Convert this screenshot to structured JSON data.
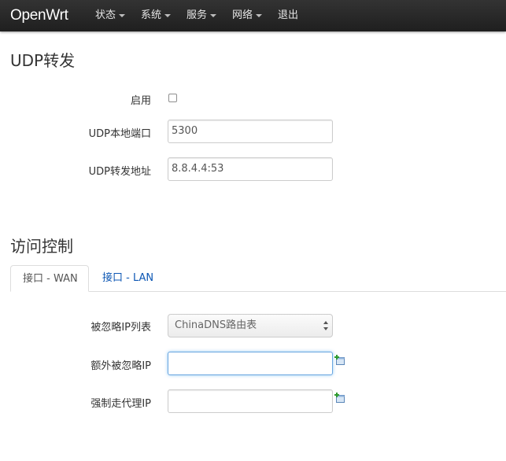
{
  "navbar": {
    "brand": "OpenWrt",
    "items": [
      {
        "label": "状态",
        "dropdown": true
      },
      {
        "label": "系统",
        "dropdown": true
      },
      {
        "label": "服务",
        "dropdown": true
      },
      {
        "label": "网络",
        "dropdown": true
      },
      {
        "label": "退出",
        "dropdown": false
      }
    ]
  },
  "udp": {
    "title": "UDP转发",
    "enable_label": "启用",
    "enable_checked": false,
    "local_port_label": "UDP本地端口",
    "local_port_value": "5300",
    "forward_addr_label": "UDP转发地址",
    "forward_addr_value": "8.8.4.4:53"
  },
  "access": {
    "title": "访问控制",
    "tabs": [
      {
        "label": "接口 - WAN",
        "active": true
      },
      {
        "label": "接口 - LAN",
        "active": false
      }
    ],
    "ignore_list_label": "被忽略IP列表",
    "ignore_list_selected": "ChinaDNS路由表",
    "extra_ignore_label": "额外被忽略IP",
    "extra_ignore_value": "",
    "force_proxy_label": "强制走代理IP",
    "force_proxy_value": ""
  },
  "colors": {
    "navbar_bg": "#222222",
    "link": "#0d57b4",
    "focus_border": "#6aa6e0"
  },
  "icons": {
    "add": "add-entry-icon",
    "caret": "caret-down-icon"
  }
}
